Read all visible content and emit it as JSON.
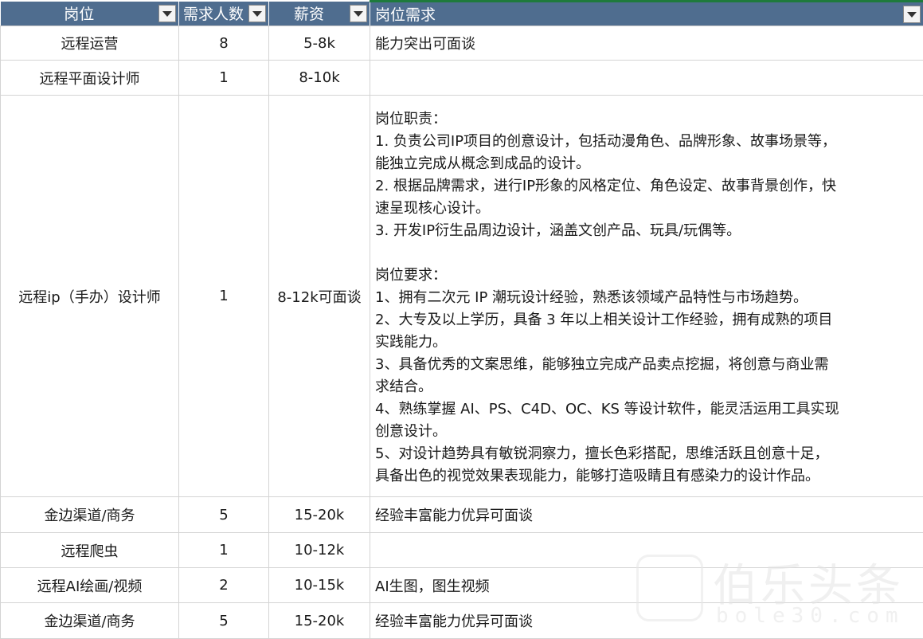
{
  "headers": [
    "岗位",
    "需求人数",
    "薪资",
    "岗位需求"
  ],
  "rows": [
    {
      "position": "远程运营",
      "count": "8",
      "salary": "5-8k",
      "requirement": "能力突出可面谈"
    },
    {
      "position": "远程平面设计师",
      "count": "1",
      "salary": "8-10k",
      "requirement": ""
    },
    {
      "position": "远程ip（手办）设计师",
      "count": "1",
      "salary": "8-12k可面谈",
      "requirement_lines": [
        "岗位职责：",
        "1. 负责公司IP项目的创意设计，包括动漫角色、品牌形象、故事场景等，",
        "能独立完成从概念到成品的设计。",
        "2. 根据品牌需求，进行IP形象的风格定位、角色设定、故事背景创作，快",
        "速呈现核心设计。",
        "3. 开发IP衍生品周边设计，涵盖文创产品、玩具/玩偶等。",
        "",
        "岗位要求：",
        "1、拥有二次元 IP 潮玩设计经验，熟悉该领域产品特性与市场趋势。",
        "2、大专及以上学历，具备 3 年以上相关设计工作经验，拥有成熟的项目",
        "实践能力。",
        "3、具备优秀的文案思维，能够独立完成产品卖点挖掘，将创意与商业需",
        "求结合。",
        "4、熟练掌握 AI、PS、C4D、OC、KS 等设计软件，能灵活运用工具实现",
        "创意设计。",
        "5、对设计趋势具有敏锐洞察力，擅长色彩搭配，思维活跃且创意十足，",
        "具备出色的视觉效果表现能力，能够打造吸睛且有感染力的设计作品。"
      ]
    },
    {
      "position": "金边渠道/商务",
      "count": "5",
      "salary": "15-20k",
      "requirement": "经验丰富能力优异可面谈"
    },
    {
      "position": "远程爬虫",
      "count": "1",
      "salary": "10-12k",
      "requirement": ""
    },
    {
      "position": "远程AI绘画/视频",
      "count": "2",
      "salary": "10-15k",
      "requirement": "AI生图，图生视频"
    },
    {
      "position": "金边渠道/商务",
      "count": "5",
      "salary": "15-20k",
      "requirement": "经验丰富能力优异可面谈"
    }
  ],
  "watermark": {
    "main": "伯乐头条",
    "sub": "bole30.com",
    "icon": "bole-logo-icon"
  },
  "colors": {
    "header_bg": "#4f6d8f",
    "header_text": "#ffffff",
    "grid": "#d4d4d4",
    "active_border": "#1e7a3c"
  }
}
